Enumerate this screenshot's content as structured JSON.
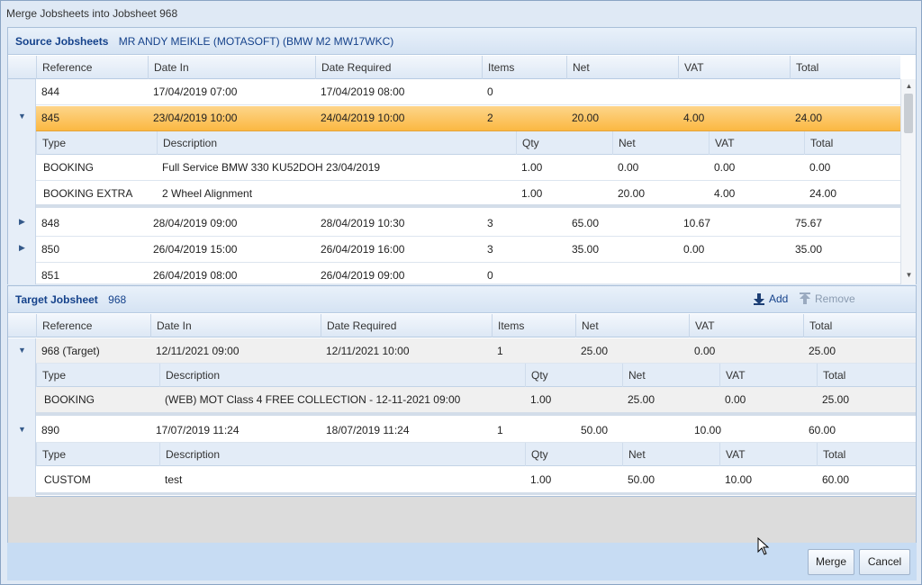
{
  "window": {
    "title": "Merge Jobsheets into Jobsheet 968"
  },
  "source": {
    "title": "Source Jobsheets",
    "subtitle": "MR ANDY MEIKLE (MOTASOFT) (BMW M2 MW17WKC)",
    "columns": [
      "Reference",
      "Date In",
      "Date Required",
      "Items",
      "Net",
      "VAT",
      "Total"
    ],
    "rows": [
      {
        "ref": "844",
        "date_in": "17/04/2019 07:00",
        "date_req": "17/04/2019 08:00",
        "items": "0",
        "net": "",
        "vat": "",
        "total": ""
      },
      {
        "ref": "845",
        "date_in": "23/04/2019 10:00",
        "date_req": "24/04/2019 10:00",
        "items": "2",
        "net": "20.00",
        "vat": "4.00",
        "total": "24.00"
      },
      {
        "ref": "848",
        "date_in": "28/04/2019 09:00",
        "date_req": "28/04/2019 10:30",
        "items": "3",
        "net": "65.00",
        "vat": "10.67",
        "total": "75.67"
      },
      {
        "ref": "850",
        "date_in": "26/04/2019 15:00",
        "date_req": "26/04/2019 16:00",
        "items": "3",
        "net": "35.00",
        "vat": "0.00",
        "total": "35.00"
      },
      {
        "ref": "851",
        "date_in": "26/04/2019 08:00",
        "date_req": "26/04/2019 09:00",
        "items": "0",
        "net": "",
        "vat": "",
        "total": ""
      }
    ],
    "detail_columns": [
      "Type",
      "Description",
      "Qty",
      "Net",
      "VAT",
      "Total"
    ],
    "detail_845": [
      {
        "type": "BOOKING",
        "desc": "Full Service BMW 330 KU52DOH 23/04/2019",
        "qty": "1.00",
        "net": "0.00",
        "vat": "0.00",
        "total": "0.00"
      },
      {
        "type": "BOOKING EXTRA",
        "desc": "2 Wheel Alignment",
        "qty": "1.00",
        "net": "20.00",
        "vat": "4.00",
        "total": "24.00"
      }
    ]
  },
  "target": {
    "title": "Target Jobsheet",
    "subtitle": "968",
    "add_label": "Add",
    "remove_label": "Remove",
    "columns": [
      "Reference",
      "Date In",
      "Date Required",
      "Items",
      "Net",
      "VAT",
      "Total"
    ],
    "detail_columns": [
      "Type",
      "Description",
      "Qty",
      "Net",
      "VAT",
      "Total"
    ],
    "rows": [
      {
        "ref": "968 (Target)",
        "date_in": "12/11/2021 09:00",
        "date_req": "12/11/2021 10:00",
        "items": "1",
        "net": "25.00",
        "vat": "0.00",
        "total": "25.00",
        "detail": {
          "type": "BOOKING",
          "desc": "(WEB) MOT Class 4 FREE COLLECTION - 12-11-2021 09:00",
          "qty": "1.00",
          "net": "25.00",
          "vat": "0.00",
          "total": "25.00"
        }
      },
      {
        "ref": "890",
        "date_in": "17/07/2019 11:24",
        "date_req": "18/07/2019 11:24",
        "items": "1",
        "net": "50.00",
        "vat": "10.00",
        "total": "60.00",
        "detail": {
          "type": "CUSTOM",
          "desc": "test",
          "qty": "1.00",
          "net": "50.00",
          "vat": "10.00",
          "total": "60.00"
        }
      }
    ]
  },
  "footer": {
    "merge_label": "Merge",
    "cancel_label": "Cancel"
  }
}
